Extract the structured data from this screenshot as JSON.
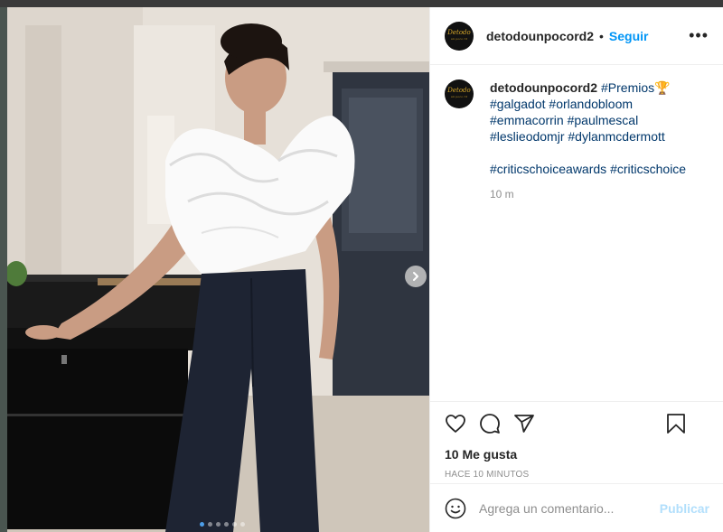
{
  "post": {
    "username": "detodounpocord2",
    "avatar_text": "Detodo",
    "avatar_subtext": "un poco rd",
    "follow_label": "Seguir",
    "separator": "•",
    "more_label": "•••"
  },
  "caption": {
    "username": "detodounpocord2",
    "line1_tag": "#Premios",
    "trophy": "🏆",
    "line2": [
      "#galgadot",
      "#orlandobloom"
    ],
    "line3": [
      "#emmacorrin",
      "#paulmescal"
    ],
    "line4": [
      "#leslieodomjr",
      "#dylanmcdermott"
    ],
    "line5": [
      "#criticschoiceawards",
      "#criticschoice"
    ],
    "time": "10 m"
  },
  "actions": {
    "likes": "10 Me gusta",
    "ago": "HACE 10 MINUTOS",
    "icons": [
      "heart-icon",
      "comment-icon",
      "share-icon",
      "bookmark-icon"
    ]
  },
  "comment": {
    "placeholder": "Agrega un comentario...",
    "publish_label": "Publicar"
  },
  "carousel": {
    "total": 6,
    "active_index": 0
  },
  "colors": {
    "link": "#00376b",
    "follow": "#0095f6",
    "publish_disabled": "#b2dffc",
    "muted": "#8e8e8e"
  }
}
